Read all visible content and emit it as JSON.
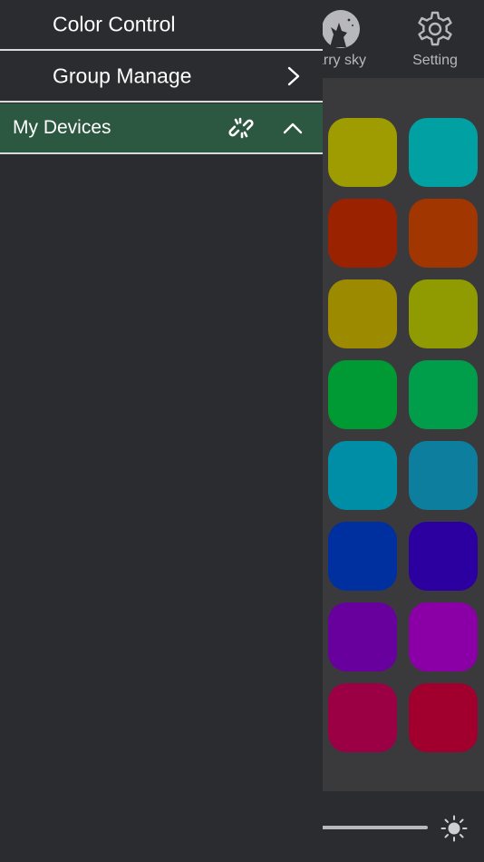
{
  "top_tabs": {
    "starry_label": "arry sky",
    "setting_label": "Setting"
  },
  "drawer": {
    "color_control": "Color Control",
    "group_manage": "Group Manage",
    "my_devices": "My Devices"
  },
  "swatches": [
    "#9e9c00",
    "#00a0a3",
    "#9a2200",
    "#a13600",
    "#9c8a00",
    "#8f9b00",
    "#009a34",
    "#009e4b",
    "#008ea6",
    "#0d7e9e",
    "#0030a0",
    "#2c00a0",
    "#68009e",
    "#8a00a6",
    "#9c0044",
    "#a1002e"
  ],
  "colors": {
    "drawer_bg": "#2b2c30",
    "devices_row_bg": "#2c5740",
    "panel_bg": "#3a3a3c"
  }
}
